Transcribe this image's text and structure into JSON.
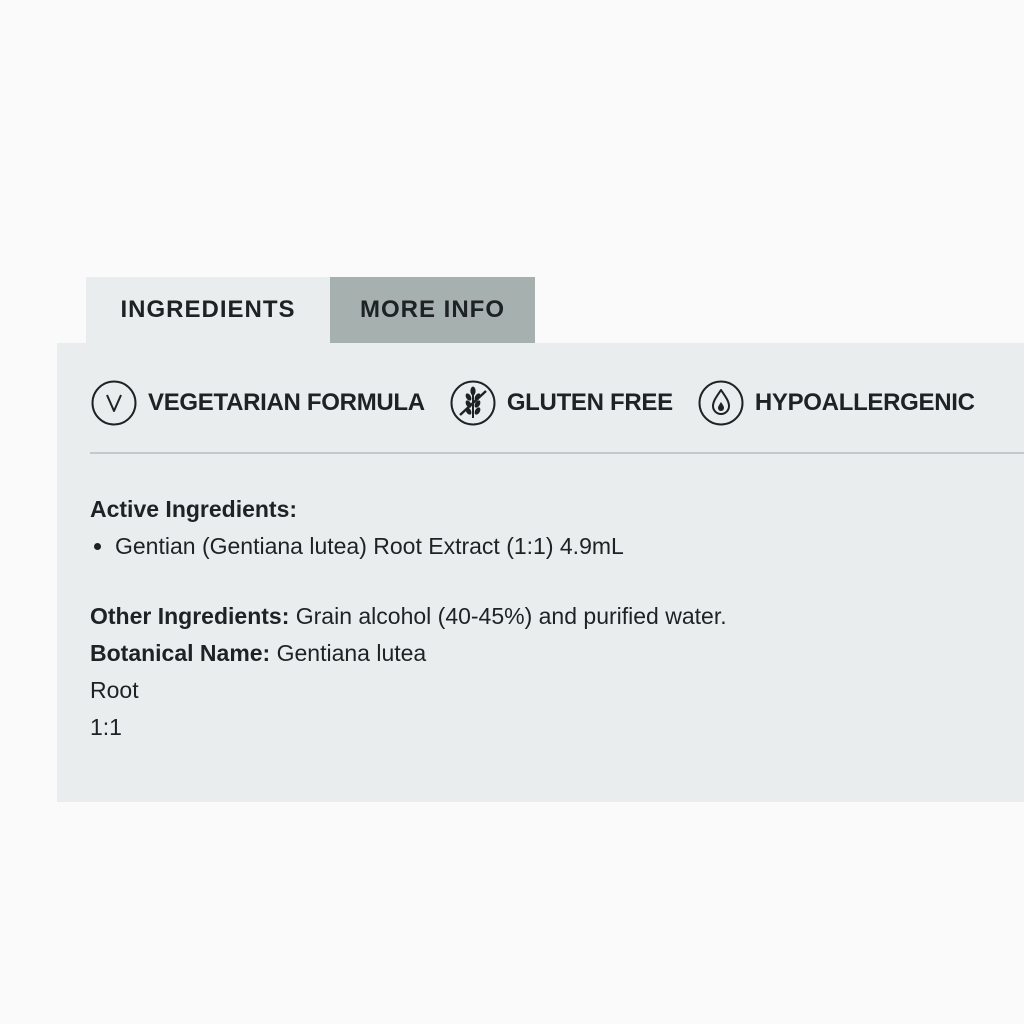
{
  "tabs": [
    {
      "label": "INGREDIENTS",
      "active": true
    },
    {
      "label": "MORE INFO",
      "active": false
    }
  ],
  "badges": [
    {
      "icon": "vegetarian-v-icon",
      "label": "VEGETARIAN FORMULA"
    },
    {
      "icon": "gluten-free-wheat-icon",
      "label": "GLUTEN FREE"
    },
    {
      "icon": "hypoallergenic-drop-icon",
      "label": "HYPOALLERGENIC"
    }
  ],
  "ingredients": {
    "active_label": "Active Ingredients:",
    "active_items": [
      "Gentian (Gentiana lutea) Root Extract (1:1) 4.9mL"
    ],
    "other_label": "Other Ingredients:",
    "other_value": "Grain alcohol (40-45%) and purified water.",
    "botanical_label": "Botanical Name:",
    "botanical_value": "Gentiana lutea",
    "plant_part": "Root",
    "ratio": "1:1"
  },
  "colors": {
    "page_background": "#fafafa",
    "panel_background": "#e9edee",
    "inactive_tab": "#a6b0ae",
    "text": "#1e2224",
    "divider": "#c3c9cb"
  }
}
